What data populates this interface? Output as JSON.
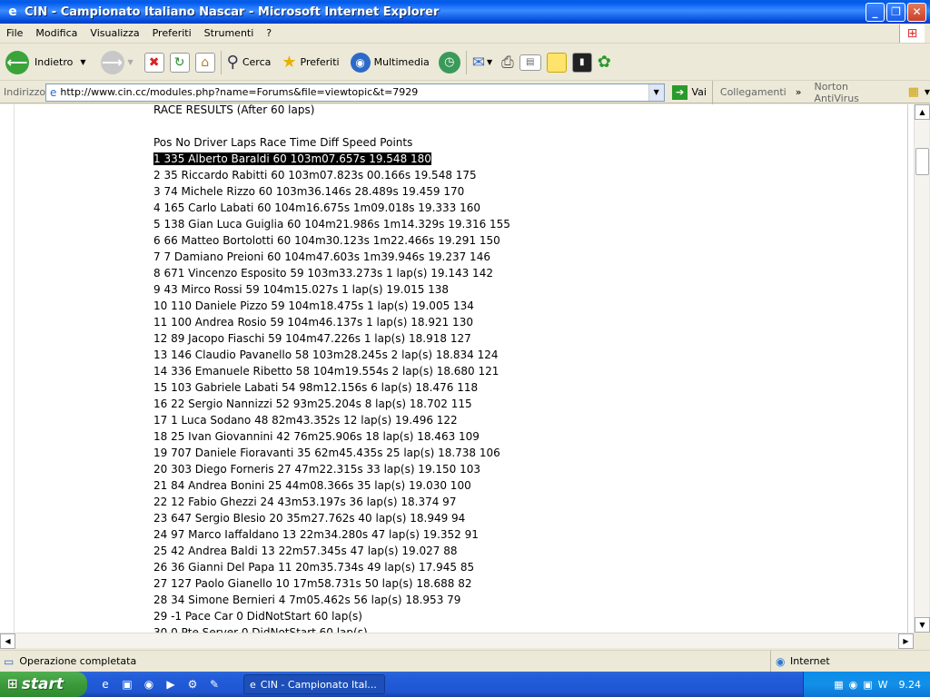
{
  "window": {
    "title": "CIN - Campionato Italiano Nascar - Microsoft Internet Explorer"
  },
  "menu": [
    "File",
    "Modifica",
    "Visualizza",
    "Preferiti",
    "Strumenti",
    "?"
  ],
  "toolbar": {
    "back": "Indietro",
    "search": "Cerca",
    "favorites": "Preferiti",
    "media": "Multimedia"
  },
  "address": {
    "label": "Indirizzo",
    "url": "http://www.cin.cc/modules.php?name=Forums&file=viewtopic&t=7929",
    "go": "Vai",
    "links": "Collegamenti",
    "norton": "Norton AntiVirus"
  },
  "content": {
    "heading": "RACE RESULTS (After 60 laps)",
    "columns": "Pos No Driver Laps Race Time Diff Speed Points",
    "rows": [
      "1 335 Alberto Baraldi 60 103m07.657s 19.548 180",
      "2 35 Riccardo Rabitti 60 103m07.823s 00.166s 19.548 175",
      "3 74 Michele Rizzo 60 103m36.146s 28.489s 19.459 170",
      "4 165 Carlo Labati 60 104m16.675s 1m09.018s 19.333 160",
      "5 138 Gian Luca Guiglia 60 104m21.986s 1m14.329s 19.316 155",
      "6 66 Matteo Bortolotti 60 104m30.123s 1m22.466s 19.291 150",
      "7 7 Damiano Preioni 60 104m47.603s 1m39.946s 19.237 146",
      "8 671 Vincenzo Esposito 59 103m33.273s 1 lap(s) 19.143 142",
      "9 43 Mirco Rossi 59 104m15.027s 1 lap(s) 19.015 138",
      "10 110 Daniele Pizzo 59 104m18.475s 1 lap(s) 19.005 134",
      "11 100 Andrea Rosio 59 104m46.137s 1 lap(s) 18.921 130",
      "12 89 Jacopo Fiaschi 59 104m47.226s 1 lap(s) 18.918 127",
      "13 146 Claudio Pavanello 58 103m28.245s 2 lap(s) 18.834 124",
      "14 336 Emanuele Ribetto 58 104m19.554s 2 lap(s) 18.680 121",
      "15 103 Gabriele Labati 54 98m12.156s 6 lap(s) 18.476 118",
      "16 22 Sergio Nannizzi 52 93m25.204s 8 lap(s) 18.702 115",
      "17 1 Luca Sodano 48 82m43.352s 12 lap(s) 19.496 122",
      "18 25 Ivan Giovannini 42 76m25.906s 18 lap(s) 18.463 109",
      "19 707 Daniele Fioravanti 35 62m45.435s 25 lap(s) 18.738 106",
      "20 303 Diego Forneris 27 47m22.315s 33 lap(s) 19.150 103",
      "21 84 Andrea Bonini 25 44m08.366s 35 lap(s) 19.030 100",
      "22 12 Fabio Ghezzi 24 43m53.197s 36 lap(s) 18.374 97",
      "23 647 Sergio Blesio 20 35m27.762s 40 lap(s) 18.949 94",
      "24 97 Marco Iaffaldano 13 22m34.280s 47 lap(s) 19.352 91",
      "25 42 Andrea Baldi 13 22m57.345s 47 lap(s) 19.027 88",
      "26 36 Gianni Del Papa 11 20m35.734s 49 lap(s) 17.945 85",
      "27 127 Paolo Gianello 10 17m58.731s 50 lap(s) 18.688 82",
      "28 34 Simone Bernieri 4 7m05.462s 56 lap(s) 18.953 79",
      "29 -1 Pace Car 0 DidNotStart 60 lap(s)",
      "30 0 Pte Server 0 DidNotStart 60 lap(s)"
    ]
  },
  "status": {
    "text": "Operazione completata",
    "zone": "Internet"
  },
  "taskbar": {
    "start": "start",
    "task": "CIN - Campionato Ital...",
    "clock": "9.24"
  }
}
